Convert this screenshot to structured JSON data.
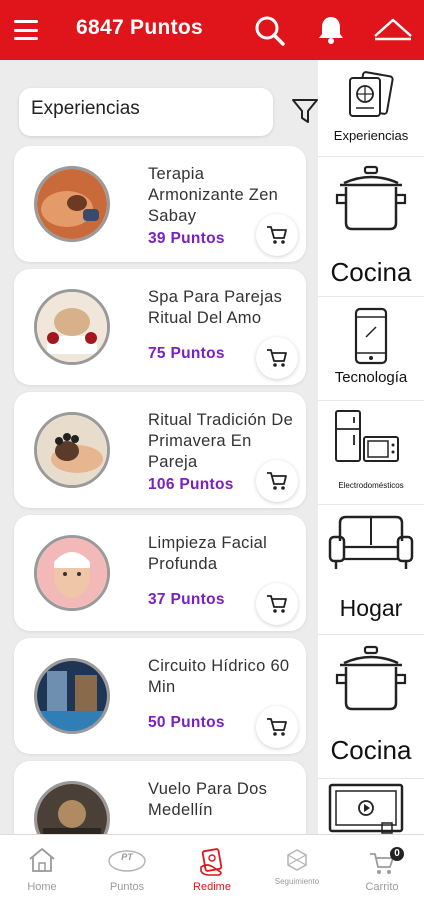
{
  "header": {
    "points_label": "6847 Puntos"
  },
  "search": {
    "value": "Experiencias"
  },
  "products": [
    {
      "name": "Terapia Armonizante Zen Sabay",
      "points": "39 Puntos"
    },
    {
      "name": "Spa Para Parejas Ritual Del Amo",
      "points": "75 Puntos"
    },
    {
      "name": "Ritual Tradición De Primavera En Pareja",
      "points": "106 Puntos"
    },
    {
      "name": "Limpieza Facial Profunda",
      "points": "37 Puntos"
    },
    {
      "name": "Circuito Hídrico 60 Min",
      "points": "50 Puntos"
    },
    {
      "name": "Vuelo Para Dos Medellín",
      "points": ""
    }
  ],
  "categories": [
    {
      "label": "Experiencias"
    },
    {
      "label": "Cocina"
    },
    {
      "label": "Tecnología"
    },
    {
      "label": "Electrodomésticos"
    },
    {
      "label": "Hogar"
    },
    {
      "label": "Cocina"
    },
    {
      "label": ""
    }
  ],
  "nav": [
    {
      "label": "Home"
    },
    {
      "label": "Puntos",
      "icon_text": "PT"
    },
    {
      "label": "Redime"
    },
    {
      "label": "Seguimiento"
    },
    {
      "label": "Carrito",
      "badge": "0"
    }
  ],
  "colors": {
    "brand_red": "#e0141b",
    "points_purple": "#7b1fc4"
  }
}
